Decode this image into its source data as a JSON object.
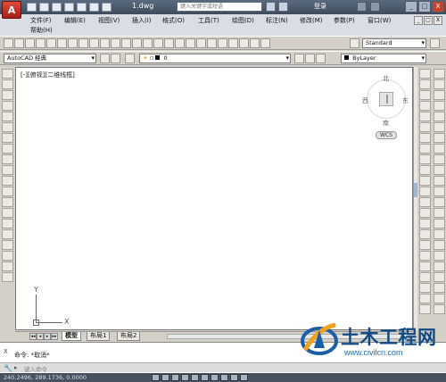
{
  "window": {
    "app_logo": "A",
    "title": "1.dwg",
    "search_placeholder": "键入关键字或短语",
    "login": "登录",
    "controls": [
      "_",
      "□",
      "X"
    ]
  },
  "menubar": {
    "row1": [
      "文件(F)",
      "编辑(E)",
      "视图(V)",
      "插入(I)",
      "格式(O)",
      "工具(T)",
      "绘图(D)",
      "标注(N)",
      "修改(M)",
      "参数(P)",
      "窗口(W)"
    ],
    "row2": [
      "帮助(H)"
    ],
    "doc_controls": [
      "_",
      "□",
      "X"
    ]
  },
  "toolbar2": {
    "text_style": "Standard"
  },
  "toolbar3": {
    "workspace": "AutoCAD 经典",
    "layer": "0",
    "linetype": "ByLayer"
  },
  "canvas": {
    "viewport_label": "[-][俯视][二维线框]",
    "viewcube": {
      "north": "北",
      "south": "南",
      "east": "东",
      "west": "西",
      "wcs": "WCS"
    },
    "ucs": {
      "x": "X",
      "y": "Y"
    }
  },
  "tabs": {
    "nav": [
      "◂◂",
      "◂",
      "▸",
      "▸▸"
    ],
    "items": [
      "模型",
      "布局1",
      "布局2"
    ]
  },
  "command": {
    "history": "命令: *取消*",
    "close": "X",
    "wrench": "🔧",
    "prompt": "▸",
    "placeholder": "键入命令"
  },
  "status": {
    "coords": "240.2496, 289.1736, 0.0000"
  },
  "watermark": {
    "title": "土木工程网",
    "url": "www.civilcn.com"
  }
}
